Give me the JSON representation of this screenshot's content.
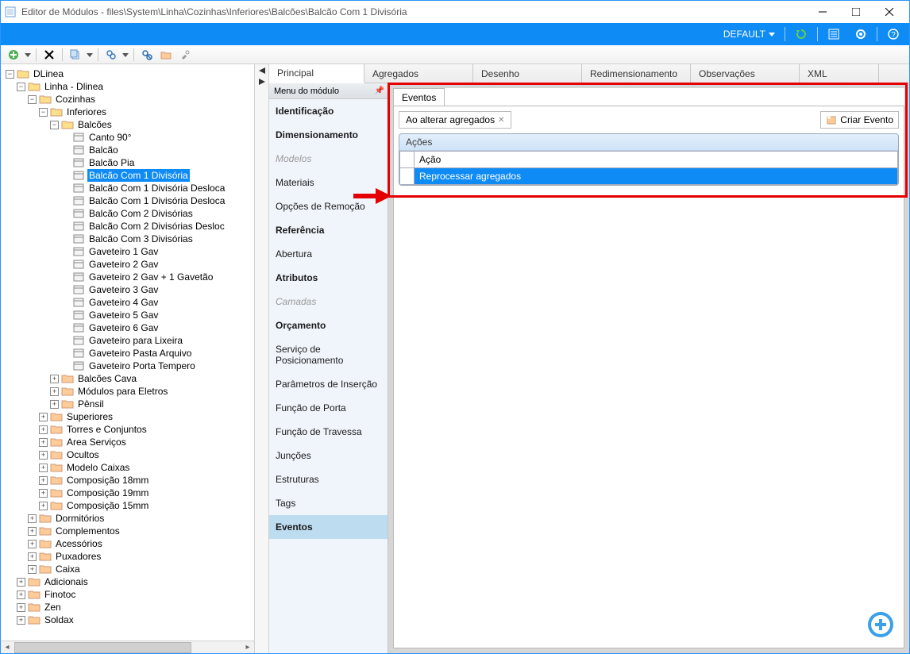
{
  "title": "Editor de Módulos - files\\System\\Linha\\Cozinhas\\Inferiores\\Balcões\\Balcão Com 1 Divisória",
  "header": {
    "default": "DEFAULT"
  },
  "tabs": {
    "principal": "Principal",
    "agregados": "Agregados",
    "desenho": "Desenho",
    "redimensionamento": "Redimensionamento",
    "observacoes": "Observações",
    "xml": "XML"
  },
  "tree": {
    "root": "DLinea",
    "n1": "Linha - Dlinea",
    "n2": "Cozinhas",
    "n3": "Inferiores",
    "n4": "Balcões",
    "leaves": [
      "Canto 90°",
      "Balcão",
      "Balcão Pia",
      "Balcão Com 1 Divisória",
      "Balcão Com 1 Divisória Desloca",
      "Balcão Com 1 Divisória Desloca",
      "Balcão Com 2 Divisórias",
      "Balcão Com 2 Divisórias Desloc",
      "Balcão Com 3 Divisórias",
      "Gaveteiro 1 Gav",
      "Gaveteiro 2 Gav",
      "Gaveteiro 2 Gav + 1 Gavetão",
      "Gaveteiro 3 Gav",
      "Gaveteiro 4 Gav",
      "Gaveteiro 5 Gav",
      "Gaveteiro 6 Gav",
      "Gaveteiro para Lixeira",
      "Gaveteiro Pasta Arquivo",
      "Gaveteiro Porta Tempero"
    ],
    "folders_l3": [
      "Balcões Cava",
      "Módulos para Eletros",
      "Pênsil"
    ],
    "folders_l2": [
      "Superiores",
      "Torres e Conjuntos",
      "Area Serviços",
      "Ocultos",
      "Modelo Caixas",
      "Composição 18mm",
      "Composição 19mm",
      "Composição 15mm"
    ],
    "folders_l1": [
      "Dormitórios",
      "Complementos",
      "Acessórios",
      "Puxadores",
      "Caixa"
    ],
    "folders_l0": [
      "Adicionais",
      "Finotoc",
      "Zen",
      "Soldax"
    ]
  },
  "menu": {
    "title": "Menu do módulo",
    "items_bold": [
      "Identificação",
      "Dimensionamento"
    ],
    "modelos": "Modelos",
    "materiais": "Materiais",
    "opcoes": "Opções de Remoção",
    "referencia": "Referência",
    "abertura": "Abertura",
    "atributos": "Atributos",
    "camadas": "Camadas",
    "orcamento": "Orçamento",
    "rest": [
      "Serviço de Posicionamento",
      "Parâmetros de Inserção",
      "Função de Porta",
      "Função de Travessa",
      "Junções",
      "Estruturas",
      "Tags"
    ],
    "eventos": "Eventos"
  },
  "content": {
    "eventos": "Eventos",
    "ao_alterar": "Ao alterar agregados",
    "criar_evento": "Criar Evento",
    "acoes": "Ações",
    "col_acao": "Ação",
    "row_reprocessar": "Reprocessar agregados"
  }
}
